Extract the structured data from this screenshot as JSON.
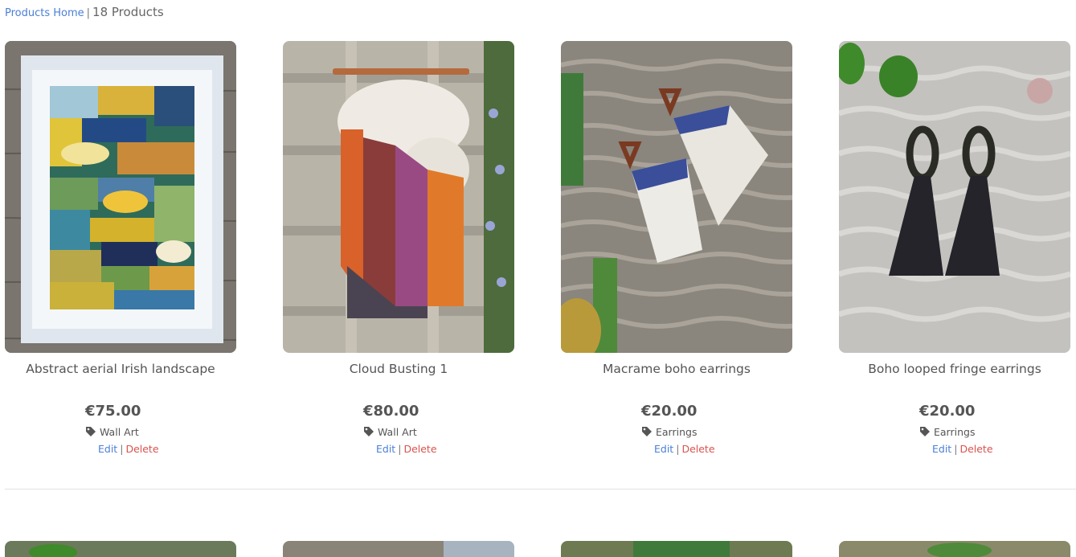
{
  "breadcrumb": {
    "home_label": "Products Home",
    "separator": "|",
    "count_label": "18 Products"
  },
  "colors": {
    "link": "#4a7fd6",
    "delete": "#d9534f",
    "text": "#555555"
  },
  "products": [
    {
      "name": "Abstract aerial Irish landscape",
      "price": "€75.00",
      "category": "Wall Art",
      "edit_label": "Edit",
      "delete_label": "Delete",
      "image_subject": "framed woven wall art"
    },
    {
      "name": "Cloud Busting 1",
      "price": "€80.00",
      "category": "Wall Art",
      "edit_label": "Edit",
      "delete_label": "Delete",
      "image_subject": "woven wall hanging with fringe"
    },
    {
      "name": "Macrame boho earrings",
      "price": "€20.00",
      "category": "Earrings",
      "edit_label": "Edit",
      "delete_label": "Delete",
      "image_subject": "macrame fringe earrings on knit"
    },
    {
      "name": "Boho looped fringe earrings",
      "price": "€20.00",
      "category": "Earrings",
      "edit_label": "Edit",
      "delete_label": "Delete",
      "image_subject": "beaded loop tassel earrings on knit"
    }
  ],
  "icons": {
    "category": "tag-icon"
  },
  "action_separator": "|"
}
